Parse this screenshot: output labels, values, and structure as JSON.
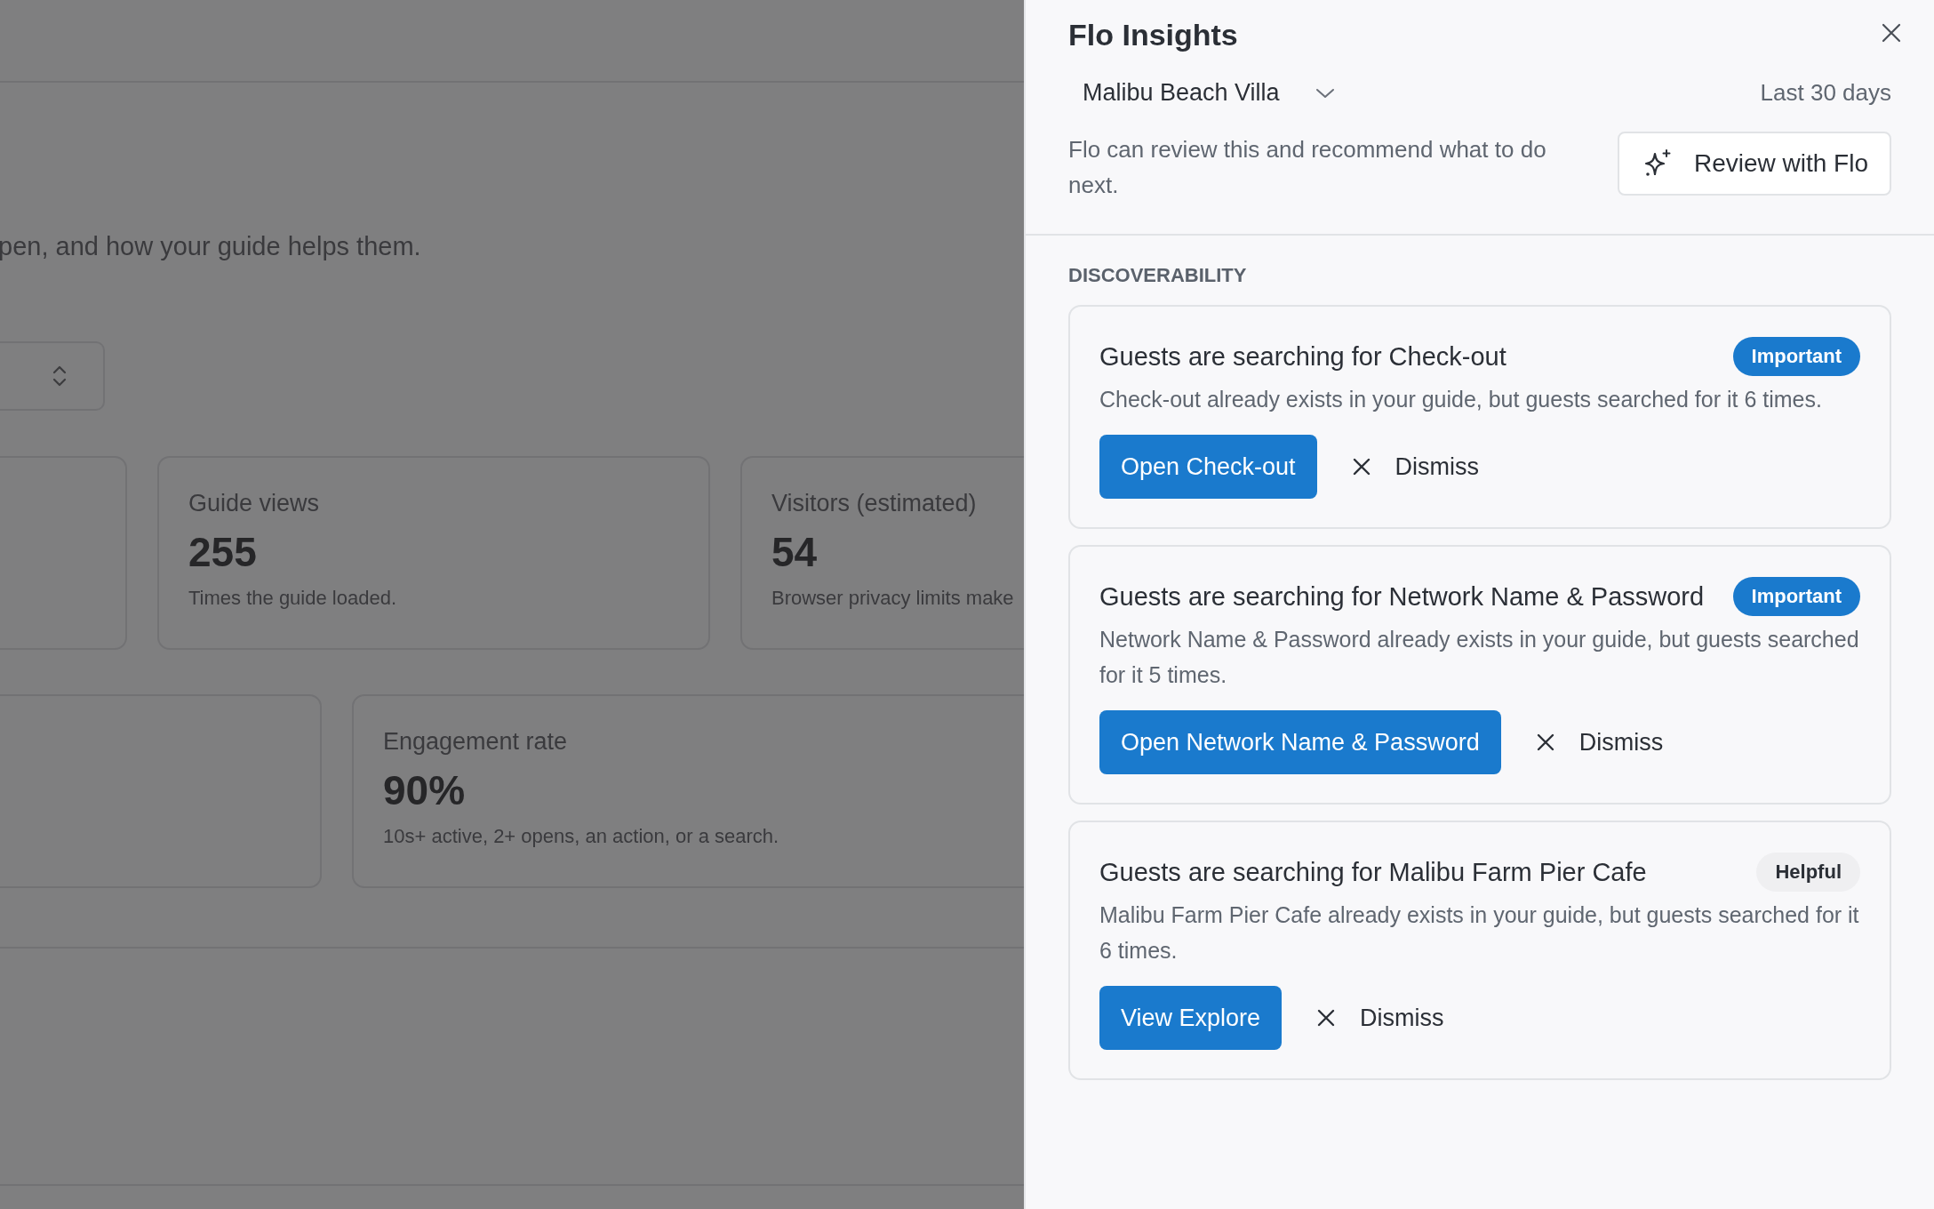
{
  "background_page": {
    "subtitle": "pen, and how your guide helps them.",
    "stat_cards": [
      {
        "label": "Guide views",
        "value": "255",
        "note": "Times the guide loaded."
      },
      {
        "label": "Visitors (estimated)",
        "value": "54",
        "note": "Browser privacy limits make"
      }
    ],
    "stat_cards_row2": [
      {
        "label": "Engagement rate",
        "value": "90%",
        "note": "10s+ active, 2+ opens, an action, or a search."
      }
    ]
  },
  "drawer": {
    "title": "Flo Insights",
    "property": "Malibu Beach Villa",
    "period": "Last 30 days",
    "review_text": "Flo can review this and recommend what to do next.",
    "review_button": "Review with Flo",
    "section": "DISCOVERABILITY",
    "insights": [
      {
        "title": "Guests are searching for Check-out",
        "badge": {
          "label": "Important",
          "kind": "important"
        },
        "description": "Check-out already exists in your guide, but guests searched for it 6 times.",
        "action": "Open Check-out",
        "dismiss": "Dismiss"
      },
      {
        "title": "Guests are searching for Network Name & Password",
        "badge": {
          "label": "Important",
          "kind": "important"
        },
        "description": "Network Name & Password already exists in your guide, but guests searched for it 5 times.",
        "action": "Open Network Name & Password",
        "dismiss": "Dismiss"
      },
      {
        "title": "Guests are searching for Malibu Farm Pier Cafe",
        "badge": {
          "label": "Helpful",
          "kind": "helpful"
        },
        "description": "Malibu Farm Pier Cafe already exists in your guide, but guests searched for it 6 times.",
        "action": "View Explore",
        "dismiss": "Dismiss"
      }
    ]
  }
}
